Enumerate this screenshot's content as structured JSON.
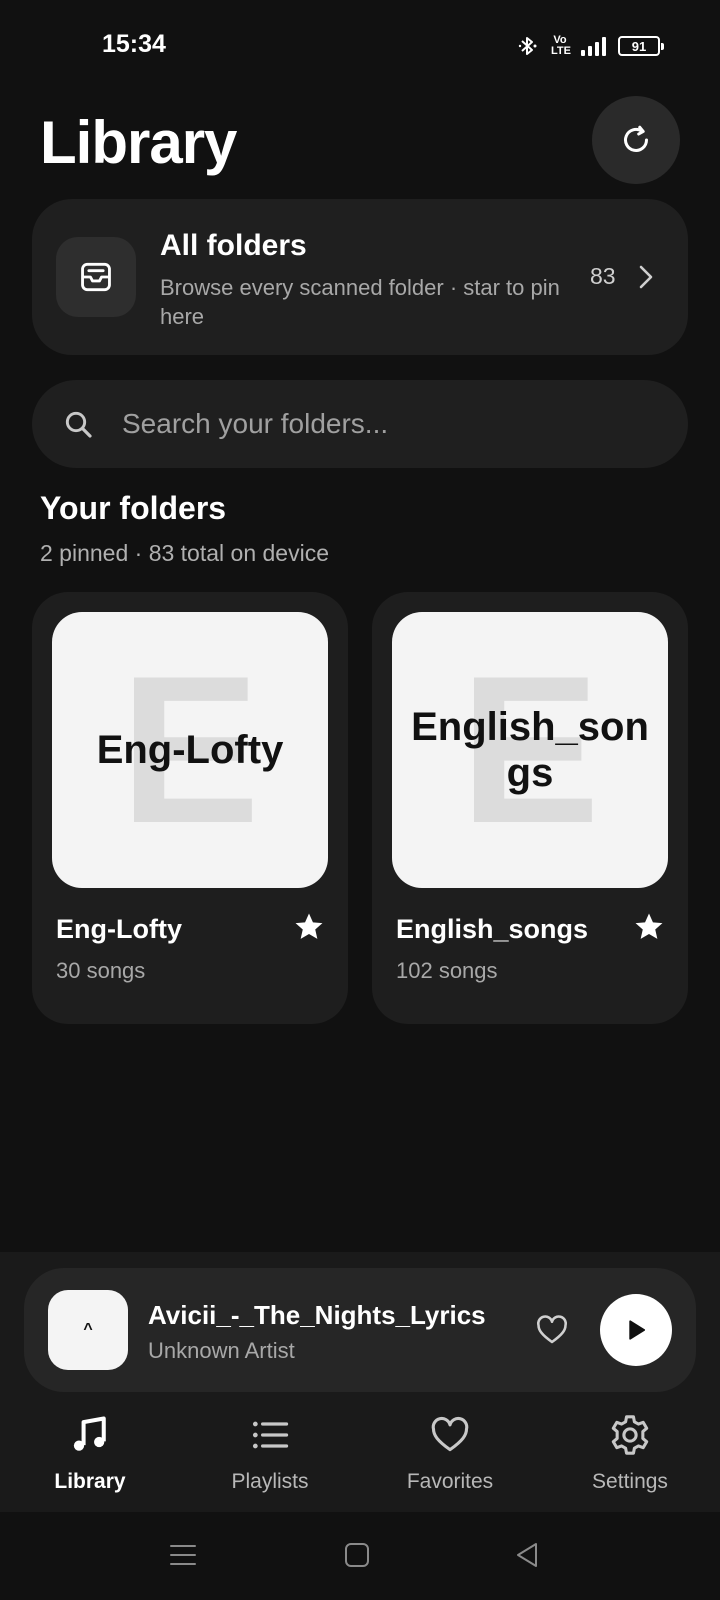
{
  "status_bar": {
    "time": "15:34",
    "volte": "Vo\nLTE",
    "battery": "91",
    "icons": [
      "bluetooth-icon",
      "volte-icon",
      "signal-icon",
      "battery-icon"
    ]
  },
  "header": {
    "title": "Library",
    "refresh_icon": "refresh-icon"
  },
  "all_folders": {
    "title": "All folders",
    "description": "Browse every scanned folder · star to pin here",
    "count": "83",
    "icon": "inbox-tray-icon"
  },
  "search": {
    "placeholder": "Search your folders..."
  },
  "section": {
    "title": "Your folders",
    "subtitle": "2 pinned · 83 total on device"
  },
  "folders": [
    {
      "art_letter": "E",
      "art_label": "Eng-Lofty",
      "name": "Eng-Lofty",
      "count": "30 songs",
      "starred": true
    },
    {
      "art_letter": "E",
      "art_label": "English_songs",
      "name": "English_songs",
      "count": "102 songs",
      "starred": true
    }
  ],
  "mini_player": {
    "art_label": "^",
    "title": "Avicii_-_The_Nights_Lyrics",
    "artist": "Unknown Artist"
  },
  "bottom_nav": {
    "items": [
      {
        "label": "Library",
        "icon": "music-note-icon",
        "active": true
      },
      {
        "label": "Playlists",
        "icon": "list-icon",
        "active": false
      },
      {
        "label": "Favorites",
        "icon": "heart-icon",
        "active": false
      },
      {
        "label": "Settings",
        "icon": "gear-icon",
        "active": false
      }
    ]
  },
  "colors": {
    "background": "#111111",
    "card": "#1f1f1f",
    "text": "#ffffff",
    "muted": "#a8a8a8"
  }
}
